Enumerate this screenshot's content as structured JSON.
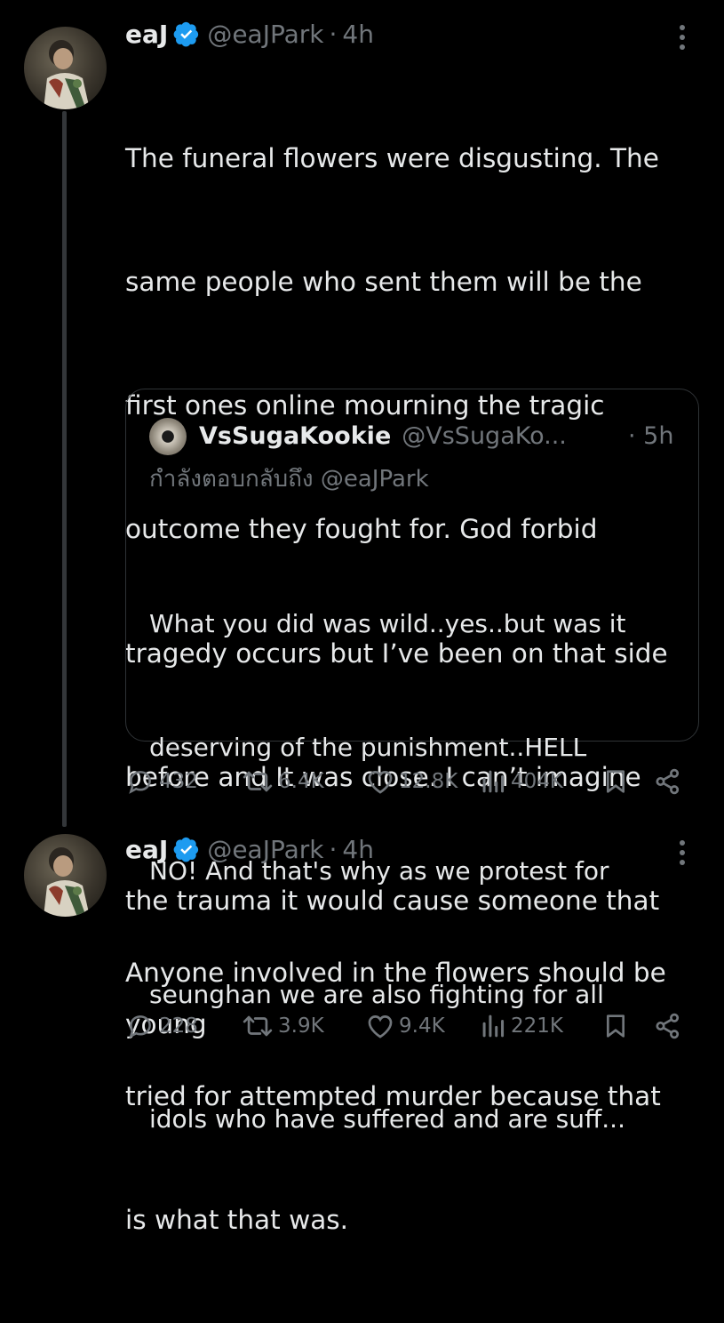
{
  "tweets": [
    {
      "author": {
        "name": "eaJ",
        "handle": "@eaJPark",
        "verified": true
      },
      "time": "4h",
      "text_lines": [
        "The funeral flowers were disgusting. The",
        "same people who sent them will be the",
        "first ones online mourning the tragic",
        "outcome they fought for. God forbid",
        "tragedy occurs but I’ve been on that side",
        "before and It was close. I can’t imagine",
        "the trauma it would cause someone that",
        "young"
      ],
      "quote": {
        "author": {
          "name": "VsSugaKookie",
          "handle": "@VsSugaKo..."
        },
        "time": "· 5h",
        "replying_to": "กำลังตอบกลับถึง @eaJPark",
        "text_lines": [
          "What you did was wild..yes..but was it",
          "deserving of the punishment..HELL",
          "NO! And that's why as we protest for",
          "seunghan we are also fighting for all",
          "idols who have suffered and are suff..."
        ]
      },
      "stats": {
        "replies": "432",
        "reposts": "6.4K",
        "likes": "12.8K",
        "views": "404K"
      }
    },
    {
      "author": {
        "name": "eaJ",
        "handle": "@eaJPark",
        "verified": true
      },
      "time": "4h",
      "text_lines": [
        "Anyone involved in the flowers should be",
        "tried for attempted murder because that",
        "is what that was."
      ],
      "stats": {
        "replies": "228",
        "reposts": "3.9K",
        "likes": "9.4K",
        "views": "221K"
      }
    }
  ],
  "icons": {
    "verified": "verified-badge-icon",
    "more": "more-vertical-icon",
    "reply": "reply-bubble-icon",
    "repost": "repost-icon",
    "like": "heart-icon",
    "views": "views-bar-icon",
    "bookmark": "bookmark-icon",
    "share": "share-icon"
  },
  "colors": {
    "background": "#000000",
    "text": "#e7e9ea",
    "muted": "#71767b",
    "verified": "#1d9bf0",
    "border": "#2f3336"
  }
}
